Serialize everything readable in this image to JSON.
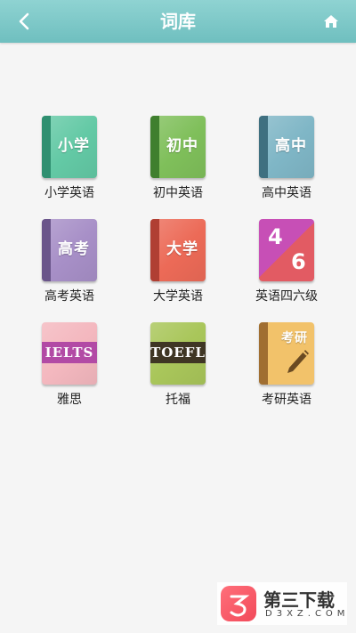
{
  "header": {
    "title": "词库"
  },
  "books": [
    {
      "label": "小学英语",
      "cover_text": "小学",
      "cover_color": "#63c9a5",
      "spine_color": "#2f8f70"
    },
    {
      "label": "初中英语",
      "cover_text": "初中",
      "cover_color": "#7fbf5a",
      "spine_color": "#3f7f2e"
    },
    {
      "label": "高中英语",
      "cover_text": "高中",
      "cover_color": "#7fb6c6",
      "spine_color": "#3f7080"
    },
    {
      "label": "高考英语",
      "cover_text": "高考",
      "cover_color": "#a78fc7",
      "spine_color": "#6a558a"
    },
    {
      "label": "大学英语",
      "cover_text": "大学",
      "cover_color": "#ec6a57",
      "spine_color": "#b03f33"
    },
    {
      "label": "英语四六级",
      "cover_text_top": "4",
      "cover_text_bottom": "6",
      "cover_color": "#c74fb6",
      "cover_color2": "#e25b63"
    },
    {
      "label": "雅思",
      "cover_text": "IELTS",
      "cover_color": "#f4b8bf",
      "band_color": "#b24aa5"
    },
    {
      "label": "托福",
      "cover_text": "TOEFL",
      "cover_color": "#a9c65a",
      "band_color": "#3f3624"
    },
    {
      "label": "考研英语",
      "cover_text": "考研",
      "cover_color": "#f2c26a",
      "spine_color": "#a06e31"
    }
  ],
  "watermark": {
    "name": "第三下载",
    "domain": "D3XZ.COM"
  }
}
